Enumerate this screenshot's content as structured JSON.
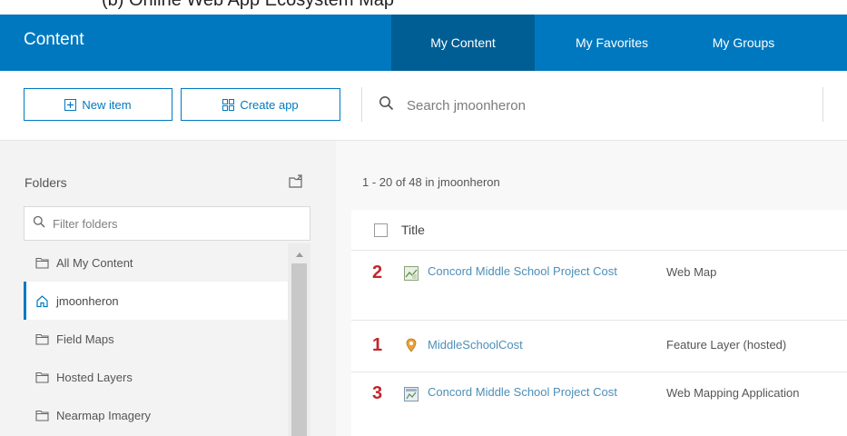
{
  "caption_fragment": "(b) Online Web App Ecosystem Map",
  "header": {
    "title": "Content",
    "tabs": [
      {
        "label": "My Content",
        "active": true
      },
      {
        "label": "My Favorites",
        "active": false
      },
      {
        "label": "My Groups",
        "active": false
      }
    ],
    "colors": {
      "bar": "#0078bf",
      "active_tab": "#005e95"
    }
  },
  "toolbar": {
    "new_item_label": "New item",
    "create_app_label": "Create app",
    "search_placeholder": "Search jmoonheron"
  },
  "sidebar": {
    "folders_title": "Folders",
    "filter_placeholder": "Filter folders",
    "items": [
      {
        "label": "All My Content",
        "icon": "folder-icon",
        "active": false
      },
      {
        "label": "jmoonheron",
        "icon": "home-icon",
        "active": true
      },
      {
        "label": "Field Maps",
        "icon": "folder-icon",
        "active": false
      },
      {
        "label": "Hosted Layers",
        "icon": "folder-icon",
        "active": false
      },
      {
        "label": "Nearmap Imagery",
        "icon": "folder-icon",
        "active": false
      }
    ]
  },
  "content": {
    "count_text": "1 - 20 of 48 in jmoonheron",
    "column_title": "Title",
    "rows": [
      {
        "number": "2",
        "icon": "web-map-icon",
        "title": "Concord Middle School Project Cost",
        "type": "Web Map"
      },
      {
        "number": "1",
        "icon": "feature-layer-icon",
        "title": "MiddleSchoolCost",
        "type": "Feature Layer (hosted)"
      },
      {
        "number": "3",
        "icon": "web-app-icon",
        "title": "Concord Middle School Project Cost",
        "type": "Web Mapping Application"
      }
    ]
  }
}
